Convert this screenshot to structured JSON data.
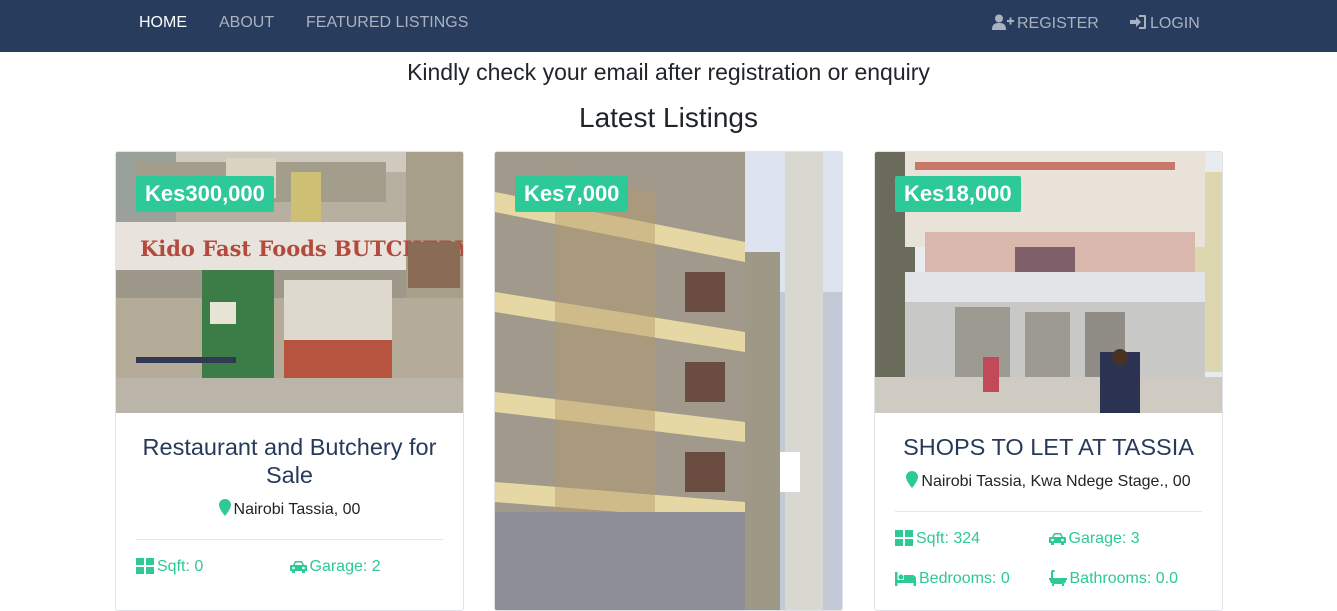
{
  "nav": {
    "home": "HOME",
    "about": "ABOUT",
    "featured": "FEATURED LISTINGS",
    "register": "REGISTER",
    "login": "LOGIN"
  },
  "notice": "Kindly check your email after registration or enquiry",
  "section_title": "Latest Listings",
  "colors": {
    "navbar": "#283c5e",
    "accent": "#2dc997",
    "title": "#263a5a"
  },
  "listings": [
    {
      "price": "Kes300,000",
      "title": "Restaurant and Butchery for Sale",
      "location": "Nairobi Tassia, 00",
      "sqft": "Sqft: 0",
      "garage": "Garage: 2",
      "image_sign": "Kido Fast Foods BUTCHERY"
    },
    {
      "price": "Kes7,000",
      "title": "",
      "location": ""
    },
    {
      "price": "Kes18,000",
      "title": "SHOPS TO LET AT TASSIA",
      "location": "Nairobi Tassia, Kwa Ndege Stage., 00",
      "sqft": "Sqft: 324",
      "garage": "Garage: 3",
      "bedrooms": "Bedrooms: 0",
      "bathrooms": "Bathrooms: 0.0"
    }
  ],
  "icons": [
    "user-plus-icon",
    "sign-in-icon",
    "map-marker-icon",
    "th-large-icon",
    "car-icon",
    "bed-icon",
    "bath-icon"
  ]
}
